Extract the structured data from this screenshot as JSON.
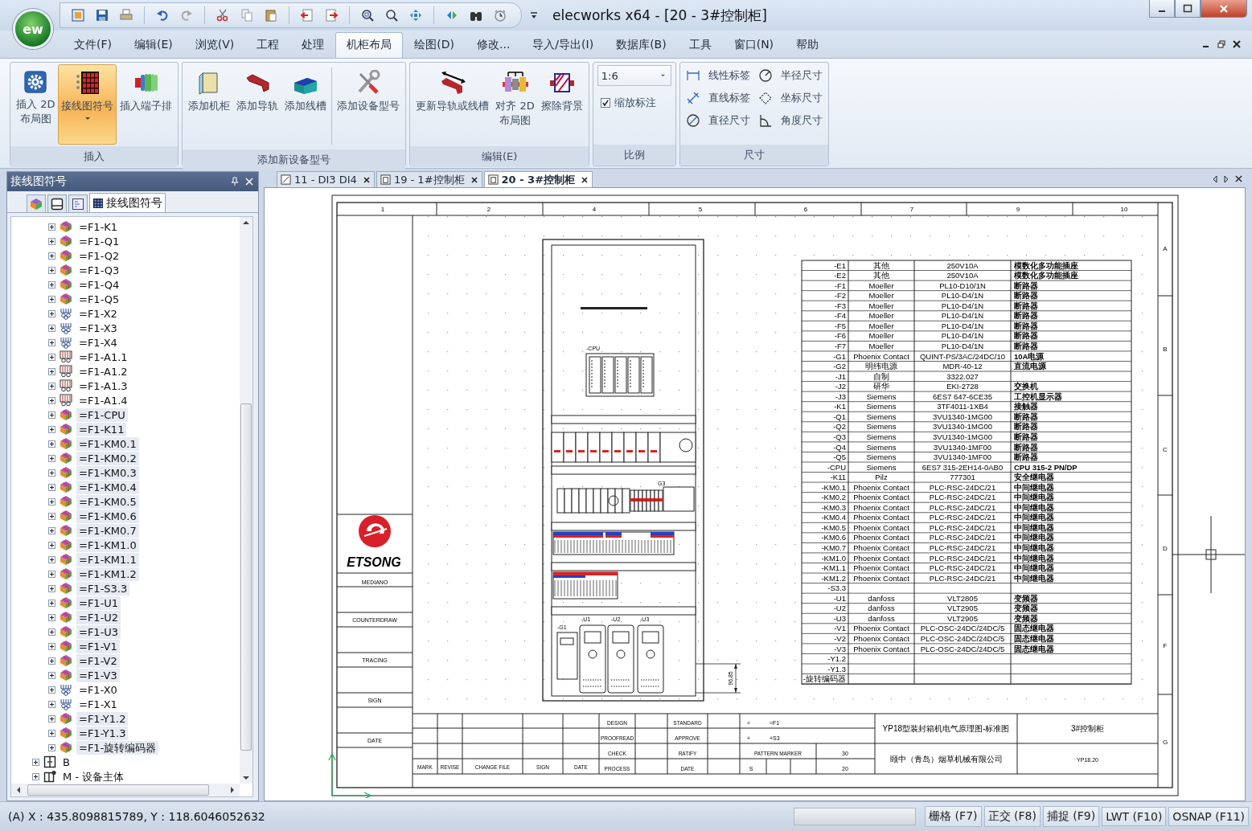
{
  "window": {
    "title": "elecworks x64 - [20 - 3#控制柜]",
    "app_badge": "ew"
  },
  "menu": [
    {
      "label": "文件(F)",
      "selected": false
    },
    {
      "label": "编辑(E)",
      "selected": false
    },
    {
      "label": "浏览(V)",
      "selected": false
    },
    {
      "label": "工程",
      "selected": false
    },
    {
      "label": "处理",
      "selected": false
    },
    {
      "label": "机柜布局",
      "selected": true
    },
    {
      "label": "绘图(D)",
      "selected": false
    },
    {
      "label": "修改...",
      "selected": false
    },
    {
      "label": "导入/导出(I)",
      "selected": false
    },
    {
      "label": "数据库(B)",
      "selected": false
    },
    {
      "label": "工具",
      "selected": false
    },
    {
      "label": "窗口(N)",
      "selected": false
    },
    {
      "label": "帮助",
      "selected": false
    }
  ],
  "ribbon": {
    "groups": [
      {
        "kind": "buttons",
        "title": "插入",
        "buttons": [
          {
            "label": "插入 2D\n布局图",
            "active": false,
            "dropdown": false
          },
          {
            "label": "接线图符号",
            "active": true,
            "dropdown": true
          },
          {
            "label": "插入端子排",
            "active": false,
            "dropdown": false
          }
        ]
      },
      {
        "kind": "buttons",
        "title": "添加新设备型号",
        "buttons": [
          {
            "label": "添加机柜",
            "active": false,
            "dropdown": false
          },
          {
            "label": "添加导轨",
            "active": false,
            "dropdown": false
          },
          {
            "label": "添加线槽",
            "active": false,
            "dropdown": false
          },
          {
            "label": "添加设备型号",
            "active": false,
            "dropdown": false
          }
        ]
      },
      {
        "kind": "buttons",
        "title": "编辑(E)",
        "buttons": [
          {
            "label": "更新导轨或线槽",
            "active": false,
            "dropdown": false
          },
          {
            "label": "对齐 2D\n布局图",
            "active": false,
            "dropdown": false
          },
          {
            "label": "擦除背景",
            "active": false,
            "dropdown": false
          }
        ]
      },
      {
        "kind": "scale",
        "title": "比例",
        "scale": "1:6",
        "checkbox": {
          "label": "缩放标注",
          "checked": true
        }
      },
      {
        "kind": "tools",
        "title": "尺寸",
        "tools": [
          {
            "label": "线性标签"
          },
          {
            "label": "半径尺寸"
          },
          {
            "label": "直线标签"
          },
          {
            "label": "坐标尺寸"
          },
          {
            "label": "直径尺寸"
          },
          {
            "label": "角度尺寸"
          }
        ]
      }
    ]
  },
  "panel": {
    "title": "接线图符号",
    "tabs": [
      {
        "kind": "components",
        "selected": false
      },
      {
        "kind": "drawings",
        "selected": false
      },
      {
        "kind": "symbols",
        "selected": false
      },
      {
        "kind": "wiring",
        "label": "接线图符号",
        "selected": true
      }
    ],
    "tree": {
      "continued_children": [
        {
          "label": "=F1-K1",
          "kind": "component",
          "expanded": false,
          "selected": false
        },
        {
          "label": "=F1-Q1",
          "kind": "component",
          "expanded": false,
          "selected": false
        },
        {
          "label": "=F1-Q2",
          "kind": "component",
          "expanded": false,
          "selected": false
        },
        {
          "label": "=F1-Q3",
          "kind": "component",
          "expanded": false,
          "selected": false
        },
        {
          "label": "=F1-Q4",
          "kind": "component",
          "expanded": false,
          "selected": false
        },
        {
          "label": "=F1-Q5",
          "kind": "component",
          "expanded": false,
          "selected": false
        },
        {
          "label": "=F1-X2",
          "kind": "terminal",
          "expanded": false,
          "selected": false
        },
        {
          "label": "=F1-X3",
          "kind": "terminal",
          "expanded": false,
          "selected": false
        },
        {
          "label": "=F1-X4",
          "kind": "terminal",
          "expanded": false,
          "selected": false
        },
        {
          "label": "=F1-A1.1",
          "kind": "rack",
          "expanded": false,
          "selected": false
        },
        {
          "label": "=F1-A1.2",
          "kind": "rack",
          "expanded": false,
          "selected": false
        },
        {
          "label": "=F1-A1.3",
          "kind": "rack",
          "expanded": false,
          "selected": false
        },
        {
          "label": "=F1-A1.4",
          "kind": "rack",
          "expanded": false,
          "selected": false
        },
        {
          "label": "=F1-CPU",
          "kind": "component",
          "expanded": false,
          "selected": true
        },
        {
          "label": "=F1-K11",
          "kind": "component",
          "expanded": false,
          "selected": true
        },
        {
          "label": "=F1-KM0.1",
          "kind": "component",
          "expanded": false,
          "selected": true
        },
        {
          "label": "=F1-KM0.2",
          "kind": "component",
          "expanded": false,
          "selected": true
        },
        {
          "label": "=F1-KM0.3",
          "kind": "component",
          "expanded": false,
          "selected": true
        },
        {
          "label": "=F1-KM0.4",
          "kind": "component",
          "expanded": false,
          "selected": true
        },
        {
          "label": "=F1-KM0.5",
          "kind": "component",
          "expanded": false,
          "selected": true
        },
        {
          "label": "=F1-KM0.6",
          "kind": "component",
          "expanded": false,
          "selected": true
        },
        {
          "label": "=F1-KM0.7",
          "kind": "component",
          "expanded": false,
          "selected": true
        },
        {
          "label": "=F1-KM1.0",
          "kind": "component",
          "expanded": false,
          "selected": true
        },
        {
          "label": "=F1-KM1.1",
          "kind": "component",
          "expanded": false,
          "selected": true
        },
        {
          "label": "=F1-KM1.2",
          "kind": "component",
          "expanded": false,
          "selected": true
        },
        {
          "label": "=F1-S3.3",
          "kind": "component",
          "expanded": false,
          "selected": true
        },
        {
          "label": "=F1-U1",
          "kind": "component",
          "expanded": false,
          "selected": true
        },
        {
          "label": "=F1-U2",
          "kind": "component",
          "expanded": false,
          "selected": true
        },
        {
          "label": "=F1-U3",
          "kind": "component",
          "expanded": false,
          "selected": true
        },
        {
          "label": "=F1-V1",
          "kind": "component",
          "expanded": false,
          "selected": true
        },
        {
          "label": "=F1-V2",
          "kind": "component",
          "expanded": false,
          "selected": true
        },
        {
          "label": "=F1-V3",
          "kind": "component",
          "expanded": false,
          "selected": true
        },
        {
          "label": "=F1-X0",
          "kind": "terminal",
          "expanded": false,
          "selected": false
        },
        {
          "label": "=F1-X1",
          "kind": "terminal",
          "expanded": false,
          "selected": false
        },
        {
          "label": "=F1-Y1.2",
          "kind": "component",
          "expanded": false,
          "selected": true
        },
        {
          "label": "=F1-Y1.3",
          "kind": "component",
          "expanded": false,
          "selected": true
        },
        {
          "label": "=F1-旋转编码器",
          "kind": "component",
          "expanded": false,
          "selected": true
        }
      ],
      "items": [
        {
          "label": "B",
          "kind": "cabinet",
          "expanded": false,
          "selected": false
        },
        {
          "label": "M - 设备主体",
          "kind": "machine",
          "expanded": false,
          "selected": false
        }
      ]
    }
  },
  "document_tabs": [
    {
      "label": "11 - DI3 DI4",
      "kind": "schematic",
      "selected": false
    },
    {
      "label": "19 - 1#控制柜",
      "kind": "layout",
      "selected": false
    },
    {
      "label": "20 - 3#控制柜",
      "kind": "layout",
      "selected": true
    }
  ],
  "drawing": {
    "column_numbers": [
      "1",
      "2",
      "4",
      "5",
      "6",
      "7",
      "9",
      "10"
    ],
    "row_letters": [
      "A",
      "B",
      "C",
      "D",
      "F",
      "G"
    ],
    "logo": "ETSONG",
    "side_labels": [
      "MEDIANO",
      "COUNTERDRAW",
      "TRACING",
      "SIGN",
      "DATE"
    ],
    "cabinet_labels": [
      "-CPU",
      "G3",
      "-G1",
      "-U1",
      "-U2",
      "-U3"
    ],
    "dimension": "96,85",
    "parts_table": [
      {
        "column_1": "-E1",
        "column_2": "其他",
        "column_3": "250V10A",
        "column_4": "模数化多功能插座"
      },
      {
        "column_1": "-E2",
        "column_2": "其他",
        "column_3": "250V10A",
        "column_4": "模数化多功能插座"
      },
      {
        "column_1": "-F1",
        "column_2": "Moeller",
        "column_3": "PL10-D10/1N",
        "column_4": "断路器"
      },
      {
        "column_1": "-F2",
        "column_2": "Moeller",
        "column_3": "PL10-D4/1N",
        "column_4": "断路器"
      },
      {
        "column_1": "-F3",
        "column_2": "Moeller",
        "column_3": "PL10-D4/1N",
        "column_4": "断路器"
      },
      {
        "column_1": "-F4",
        "column_2": "Moeller",
        "column_3": "PL10-D4/1N",
        "column_4": "断路器"
      },
      {
        "column_1": "-F5",
        "column_2": "Moeller",
        "column_3": "PL10-D4/1N",
        "column_4": "断路器"
      },
      {
        "column_1": "-F6",
        "column_2": "Moeller",
        "column_3": "PL10-D4/1N",
        "column_4": "断路器"
      },
      {
        "column_1": "-F7",
        "column_2": "Moeller",
        "column_3": "PL10-D4/1N",
        "column_4": "断路器"
      },
      {
        "column_1": "-G1",
        "column_2": "Phoenix Contact",
        "column_3": "QUINT-PS/3AC/24DC/10",
        "column_4": "10A电源"
      },
      {
        "column_1": "-G2",
        "column_2": "明纬电源",
        "column_3": "MDR-40-12",
        "column_4": "直流电源"
      },
      {
        "column_1": "-J1",
        "column_2": "自制",
        "column_3": "3322.027"
      },
      {
        "column_1": "-J2",
        "column_2": "研华",
        "column_3": "EKI-2728",
        "column_4": "交换机"
      },
      {
        "column_1": "-J3",
        "column_2": "Siemens",
        "column_3": "6ES7 647-6CE35",
        "column_4": "工控机显示器"
      },
      {
        "column_1": "-K1",
        "column_2": "Siemens",
        "column_3": "3TF4011-1XB4",
        "column_4": "接触器"
      },
      {
        "column_1": "-Q1",
        "column_2": "Siemens",
        "column_3": "3VU1340-1MG00",
        "column_4": "断路器"
      },
      {
        "column_1": "-Q2",
        "column_2": "Siemens",
        "column_3": "3VU1340-1MG00",
        "column_4": "断路器"
      },
      {
        "column_1": "-Q3",
        "column_2": "Siemens",
        "column_3": "3VU1340-1MG00",
        "column_4": "断路器"
      },
      {
        "column_1": "-Q4",
        "column_2": "Siemens",
        "column_3": "3VU1340-1MF00",
        "column_4": "断路器"
      },
      {
        "column_1": "-Q5",
        "column_2": "Siemens",
        "column_3": "3VU1340-1MF00",
        "column_4": "断路器"
      },
      {
        "column_1": "-CPU",
        "column_2": "Siemens",
        "column_3": "6ES7 315-2EH14-0AB0",
        "column_4": "CPU 315-2 PN/DP"
      },
      {
        "column_1": "-K11",
        "column_2": "Pilz",
        "column_3": "777301",
        "column_4": "安全继电器"
      },
      {
        "column_1": "-KM0.1",
        "column_2": "Phoenix Contact",
        "column_3": "PLC-RSC-24DC/21",
        "column_4": "中间继电器"
      },
      {
        "column_1": "-KM0.2",
        "column_2": "Phoenix Contact",
        "column_3": "PLC-RSC-24DC/21",
        "column_4": "中间继电器"
      },
      {
        "column_1": "-KM0.3",
        "column_2": "Phoenix Contact",
        "column_3": "PLC-RSC-24DC/21",
        "column_4": "中间继电器"
      },
      {
        "column_1": "-KM0.4",
        "column_2": "Phoenix Contact",
        "column_3": "PLC-RSC-24DC/21",
        "column_4": "中间继电器"
      },
      {
        "column_1": "-KM0.5",
        "column_2": "Phoenix Contact",
        "column_3": "PLC-RSC-24DC/21",
        "column_4": "中间继电器"
      },
      {
        "column_1": "-KM0.6",
        "column_2": "Phoenix Contact",
        "column_3": "PLC-RSC-24DC/21",
        "column_4": "中间继电器"
      },
      {
        "column_1": "-KM0.7",
        "column_2": "Phoenix Contact",
        "column_3": "PLC-RSC-24DC/21",
        "column_4": "中间继电器"
      },
      {
        "column_1": "-KM1.0",
        "column_2": "Phoenix Contact",
        "column_3": "PLC-RSC-24DC/21",
        "column_4": "中间继电器"
      },
      {
        "column_1": "-KM1.1",
        "column_2": "Phoenix Contact",
        "column_3": "PLC-RSC-24DC/21",
        "column_4": "中间继电器"
      },
      {
        "column_1": "-KM1.2",
        "column_2": "Phoenix Contact",
        "column_3": "PLC-RSC-24DC/21",
        "column_4": "中间继电器"
      },
      {
        "column_1": "-S3.3"
      },
      {
        "column_1": "-U1",
        "column_2": "danfoss",
        "column_3": "VLT2805",
        "column_4": "变频器"
      },
      {
        "column_1": "-U2",
        "column_2": "danfoss",
        "column_3": "VLT2905",
        "column_4": "变频器"
      },
      {
        "column_1": "-U3",
        "column_2": "danfoss",
        "column_3": "VLT2905",
        "column_4": "变频器"
      },
      {
        "column_1": "-V1",
        "column_2": "Phoenix Contact",
        "column_3": "PLC-OSC-24DC/24DC/5",
        "column_4": "固态继电器"
      },
      {
        "column_1": "-V2",
        "column_2": "Phoenix Contact",
        "column_3": "PLC-OSC-24DC/24DC/5",
        "column_4": "固态继电器"
      },
      {
        "column_1": "-V3",
        "column_2": "Phoenix Contact",
        "column_3": "PLC-OSC-24DC/24DC/5",
        "column_4": "固态继电器"
      },
      {
        "column_1": "-Y1.2"
      },
      {
        "column_1": "-Y1.3"
      },
      {
        "column_1": "-旋转编码器"
      }
    ],
    "title_block": {
      "revision_headers": [
        "MARK",
        "REVISE",
        "CHANGE FILE",
        "SIGN",
        "DATE"
      ],
      "roles": [
        "DESIGN",
        "PROOFREAD",
        "CHECK",
        "PROCESS"
      ],
      "approvals": [
        "STANDARD",
        "APPROVE",
        "RATIFY",
        "DATE"
      ],
      "designations": [
        {
          "symbol": "=",
          "value": "=F1"
        },
        {
          "symbol": "+",
          "value": "+S3"
        }
      ],
      "pattern_marker": {
        "label": "PATTERN MARKER",
        "value": "30"
      },
      "scale_row": {
        "symbol": "S",
        "value": "20"
      },
      "drawing_title": "YP18型装封箱机电气原理图-标准图",
      "company": "颐中（青岛）烟草机械有限公司",
      "sheet_name": "3#控制柜",
      "drawing_number": "YP18.20"
    }
  },
  "status_bar": {
    "coordinates": "(A) X : 435.8098815789, Y : 118.6046052632",
    "toggles": [
      "栅格 (F7)",
      "正交 (F8)",
      "捕捉 (F9)",
      "LWT (F10)",
      "OSNAP (F11)"
    ]
  }
}
